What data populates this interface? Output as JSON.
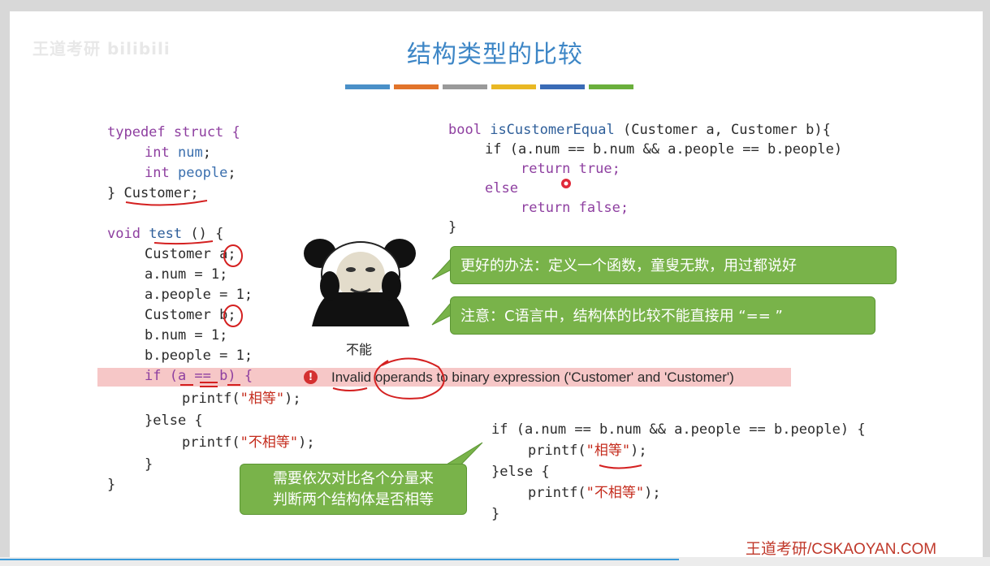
{
  "title": "结构类型的比较",
  "watermark": "王道考研 bilibili",
  "stripe_colors": [
    "#4a90c8",
    "#e2742b",
    "#9a9a9a",
    "#e9b824",
    "#3a6bb6",
    "#6aaf3c"
  ],
  "code_left": {
    "typedef_kw": "typedef struct {",
    "int1": "int",
    "num_field": "num",
    "int2": "int",
    "people_field": "people",
    "close_customer": "} Customer;",
    "void_kw": "void",
    "test_fn": "test",
    "test_rest": " () {",
    "cust_a": "Customer a;",
    "a_num": "a.num = 1;",
    "a_people": "a.people = 1;",
    "cust_b": "Customer b;",
    "b_num": "b.num = 1;",
    "b_people": "b.people = 1;",
    "if_line": "if (a == b) {",
    "printf1_pre": "printf(",
    "printf1_str": "\"相等\"",
    "printf1_post": ");",
    "else_line": "}else {",
    "printf2_pre": "printf(",
    "printf2_str": "\"不相等\"",
    "printf2_post": ");",
    "close_inner": "}",
    "close_outer": "}"
  },
  "code_right_top": {
    "bool_kw": "bool",
    "fn_name": "isCustomerEqual",
    "params": " (Customer a, Customer b){",
    "if_line": "if (a.num == b.num && a.people == b.people)",
    "return_true": "return true;",
    "else_kw": "else",
    "return_false": "return false;",
    "close": "}"
  },
  "code_right_bottom": {
    "if_line": "if (a.num == b.num && a.people == b.people) {",
    "printf1_pre": "printf(",
    "printf1_str": "\"相等\"",
    "printf1_post": ");",
    "else_line": "}else {",
    "printf2_pre": "printf(",
    "printf2_str": "\"不相等\"",
    "printf2_post": ");",
    "close": "}"
  },
  "error": {
    "icon": "!",
    "message": "Invalid operands to binary expression ('Customer' and 'Customer')"
  },
  "callouts": {
    "better_way": "更好的办法：定义一个函数，童叟无欺，用过都说好",
    "note": "注意：C语言中，结构体的比较不能直接用 “== ”",
    "compare_line1": "需要依次对比各个分量来",
    "compare_line2": "判断两个结构体是否相等"
  },
  "meme_caption": "不能",
  "footer": "王道考研/CSKAOYAN.COM"
}
